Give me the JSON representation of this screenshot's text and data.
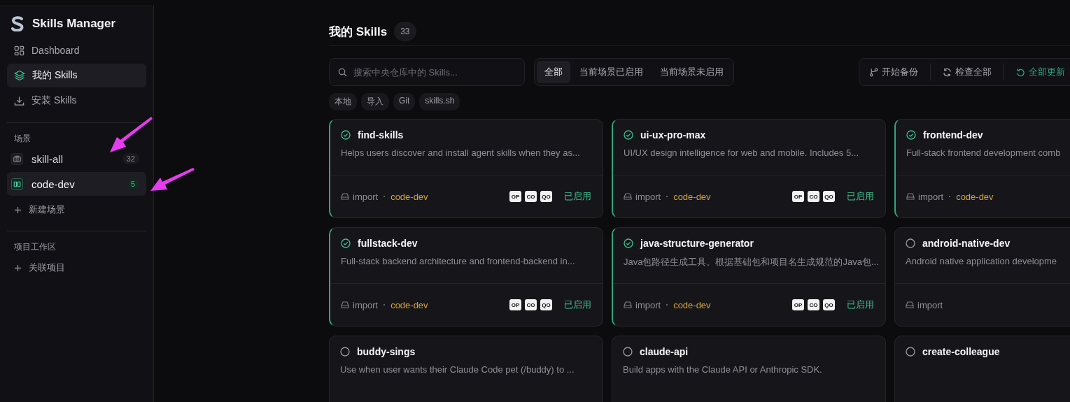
{
  "app": {
    "title": "Skills Manager"
  },
  "nav": [
    {
      "label": "Dashboard",
      "kind": "grid",
      "selected": false
    },
    {
      "label": "我的 Skills",
      "kind": "layers",
      "selected": true
    },
    {
      "label": "安装 Skills",
      "kind": "download",
      "selected": false
    }
  ],
  "scenes": {
    "heading": "场景",
    "items": [
      {
        "label": "skill-all",
        "count": "32",
        "selected": false,
        "kind": "arrow-above"
      },
      {
        "label": "code-dev",
        "count": "5",
        "selected": true,
        "kind": "arrow-right"
      }
    ],
    "add": "新建场景"
  },
  "workspace": {
    "heading": "项目工作区",
    "add": "关联项目"
  },
  "page": {
    "title": "我的 Skills",
    "count": "33"
  },
  "search": {
    "placeholder": "搜索中央仓库中的 Skills..."
  },
  "filters": [
    {
      "label": "全部",
      "selected": true
    },
    {
      "label": "当前场景已启用",
      "selected": false
    },
    {
      "label": "当前场景未启用",
      "selected": false
    }
  ],
  "actions": [
    {
      "label": "开始备份",
      "kind": "branch"
    },
    {
      "label": "检查全部",
      "kind": "refresh"
    },
    {
      "label": "全部更新",
      "kind": "update"
    }
  ],
  "source_tags": [
    "本地",
    "导入",
    "Git",
    "skills.sh"
  ],
  "cards": [
    {
      "name": "find-skills",
      "description": "Helps users discover and install agent skills when they as...",
      "enabled": true,
      "source": "import",
      "scene": "code-dev",
      "agents": [
        "OP",
        "CO",
        "QO"
      ],
      "status": "已启用"
    },
    {
      "name": "ui-ux-pro-max",
      "description": "UI/UX design intelligence for web and mobile. Includes 5...",
      "enabled": true,
      "source": "import",
      "scene": "code-dev",
      "agents": [
        "OP",
        "CO",
        "QO"
      ],
      "status": "已启用"
    },
    {
      "name": "frontend-dev",
      "description": "Full-stack frontend development comb",
      "enabled": true,
      "source": "import",
      "scene": "code-dev"
    },
    {
      "name": "fullstack-dev",
      "description": "Full-stack backend architecture and frontend-backend in...",
      "enabled": true,
      "source": "import",
      "scene": "code-dev",
      "agents": [
        "OP",
        "CO",
        "QO"
      ],
      "status": "已启用"
    },
    {
      "name": "java-structure-generator",
      "description": "Java包路径生成工具。根据基础包和项目名生成规范的Java包...",
      "enabled": true,
      "source": "import",
      "scene": "code-dev",
      "agents": [
        "OP",
        "CO",
        "QO"
      ],
      "status": "已启用"
    },
    {
      "name": "android-native-dev",
      "description": "Android native application developme",
      "enabled": false,
      "source": "import"
    },
    {
      "name": "buddy-sings",
      "description": "Use when user wants their Claude Code pet (/buddy) to ...",
      "enabled": false
    },
    {
      "name": "claude-api",
      "description": "Build apps with the Claude API or Anthropic SDK.",
      "enabled": false
    },
    {
      "name": "create-colleague",
      "enabled": false
    }
  ]
}
